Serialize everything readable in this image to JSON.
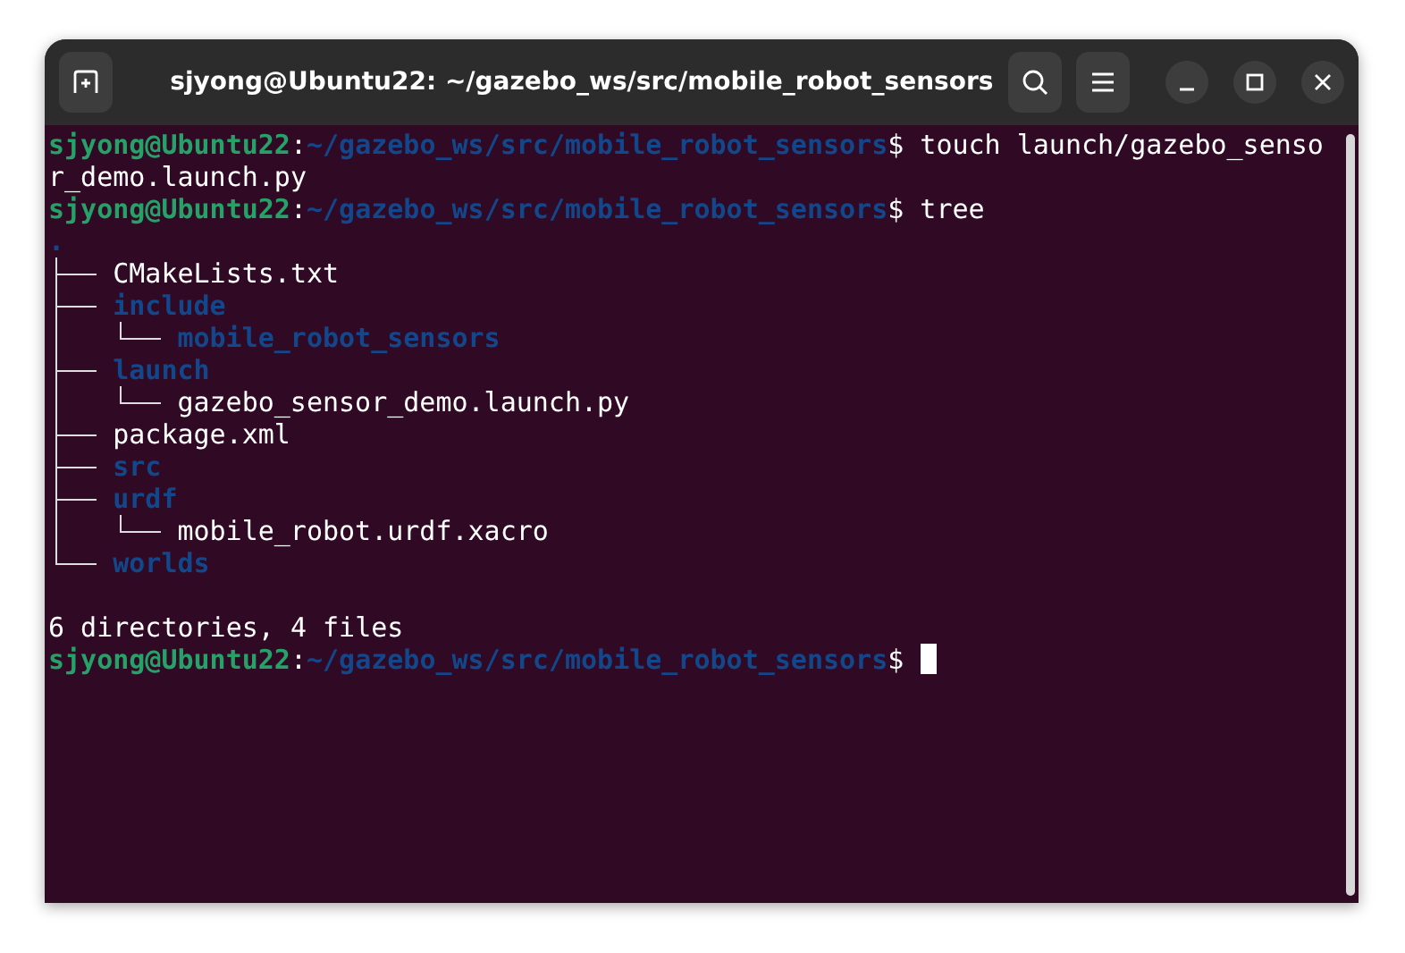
{
  "window": {
    "title": "sjyong@Ubuntu22: ~/gazebo_ws/src/mobile_robot_sensors"
  },
  "terminal": {
    "lines": [
      {
        "kind": "prompt",
        "user": "sjyong@Ubuntu22",
        "separator": ":",
        "path": "~/gazebo_ws/src/mobile_robot_sensors",
        "symbol": "$",
        "command": "touch launch/gazebo_sensor_demo.launch.py",
        "cursor": false
      },
      {
        "kind": "prompt",
        "user": "sjyong@Ubuntu22",
        "separator": ":",
        "path": "~/gazebo_ws/src/mobile_robot_sensors",
        "symbol": "$",
        "command": "tree",
        "cursor": false
      },
      {
        "kind": "tree",
        "root": ".",
        "children": [
          {
            "name": "CMakeLists.txt",
            "kind": "file"
          },
          {
            "name": "include",
            "kind": "dir",
            "children": [
              {
                "name": "mobile_robot_sensors",
                "kind": "dir"
              }
            ]
          },
          {
            "name": "launch",
            "kind": "dir",
            "children": [
              {
                "name": "gazebo_sensor_demo.launch.py",
                "kind": "file"
              }
            ]
          },
          {
            "name": "package.xml",
            "kind": "file"
          },
          {
            "name": "src",
            "kind": "dir"
          },
          {
            "name": "urdf",
            "kind": "dir",
            "children": [
              {
                "name": "mobile_robot.urdf.xacro",
                "kind": "file"
              }
            ]
          },
          {
            "name": "worlds",
            "kind": "dir"
          }
        ]
      },
      {
        "kind": "blank"
      },
      {
        "kind": "output",
        "text": "6 directories, 4 files"
      },
      {
        "kind": "prompt",
        "user": "sjyong@Ubuntu22",
        "separator": ":",
        "path": "~/gazebo_ws/src/mobile_robot_sensors",
        "symbol": "$",
        "cursor": true
      }
    ]
  }
}
